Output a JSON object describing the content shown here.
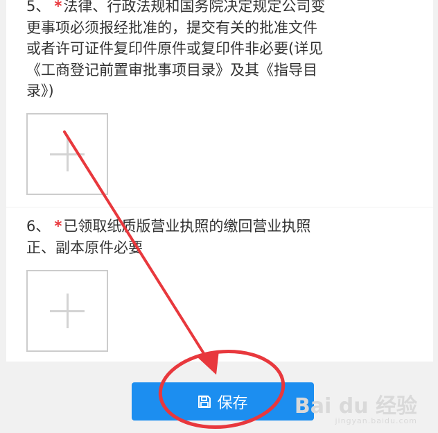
{
  "items": [
    {
      "number": "5、",
      "required_mark": "*",
      "text": "法律、行政法规和国务院决定规定公司变更事项必须报经批准的，提交有关的批准文件或者许可证件复印件原件或复印件非必要(详见《工商登记前置审批事项目录》及其《指导目录》)",
      "upload_icon": "plus-icon"
    },
    {
      "number": "6、",
      "required_mark": "*",
      "text": "已领取纸质版营业执照的缴回营业执照正、副本原件必要",
      "upload_icon": "plus-icon"
    }
  ],
  "save_button": {
    "label": "保存",
    "icon": "save-icon",
    "color": "#1c8ef0"
  },
  "annotation": {
    "color": "#e8383d"
  },
  "watermark": {
    "logo": "Bai du 经验",
    "sub": "jingyan.baidu.com"
  }
}
